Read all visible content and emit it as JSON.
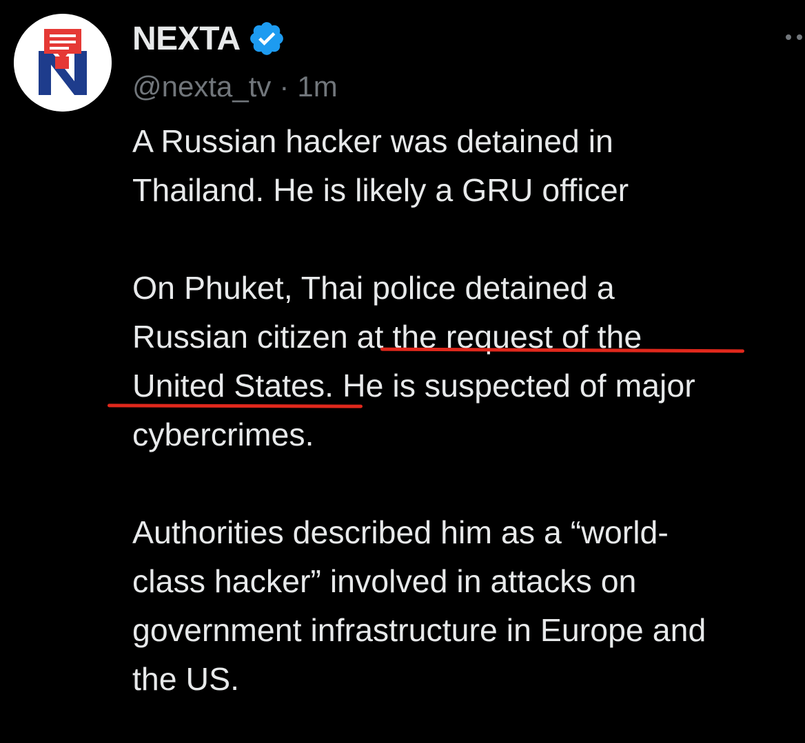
{
  "account": {
    "display_name": "NEXTA",
    "handle": "@nexta_tv",
    "separator": "·",
    "time": "1m",
    "avatar_icon": "nexta-logo-icon",
    "verified_icon": "verified-badge-icon",
    "more_icon": "more-options-icon"
  },
  "tweet": {
    "lines": [
      "A Russian hacker was detained in",
      "Thailand. He is likely a GRU officer",
      "",
      "On Phuket, Thai police detained a",
      "Russian citizen at the request of the",
      "United States. He is suspected of major",
      "cybercrimes.",
      "",
      "Authorities described him as a “world-",
      "class hacker” involved in attacks on",
      "government infrastructure in Europe and",
      "the US."
    ],
    "highlighted_phrase": "at the request of the United States."
  },
  "colors": {
    "background": "#000000",
    "text": "#e7e9ea",
    "muted": "#71767b",
    "verified_blue": "#1d9bf0",
    "annotation_red": "#e0281c",
    "logo_blue": "#1e3c8c",
    "logo_red": "#e53935"
  }
}
